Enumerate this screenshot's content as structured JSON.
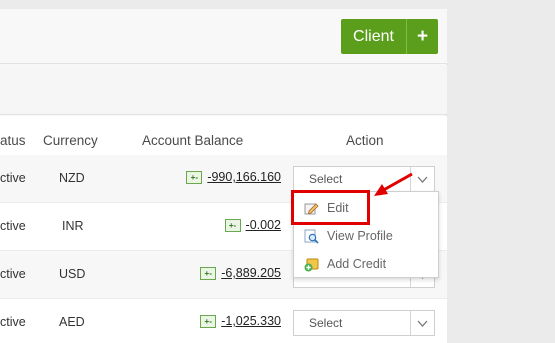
{
  "header": {
    "client_button_label": "Client",
    "client_button_plus": "+"
  },
  "table": {
    "columns": {
      "status": "atus",
      "currency": "Currency",
      "balance": "Account Balance",
      "action": "Action"
    },
    "rows": [
      {
        "status": "ctive",
        "currency": "NZD",
        "balance": "-990,166.160",
        "action": "Select"
      },
      {
        "status": "ctive",
        "currency": "INR",
        "balance": "-0.002",
        "action": ""
      },
      {
        "status": "ctive",
        "currency": "USD",
        "balance": "-6,889.205",
        "action": ""
      },
      {
        "status": "ctive",
        "currency": "AED",
        "balance": "-1,025.330",
        "action": "Select"
      }
    ]
  },
  "action_menu": {
    "items": [
      {
        "label": "Edit",
        "icon": "edit-icon"
      },
      {
        "label": "View Profile",
        "icon": "view-profile-icon"
      },
      {
        "label": "Add Credit",
        "icon": "add-credit-icon"
      }
    ]
  },
  "colors": {
    "brand_green": "#5a9e1c",
    "highlight_red": "#e00000"
  }
}
